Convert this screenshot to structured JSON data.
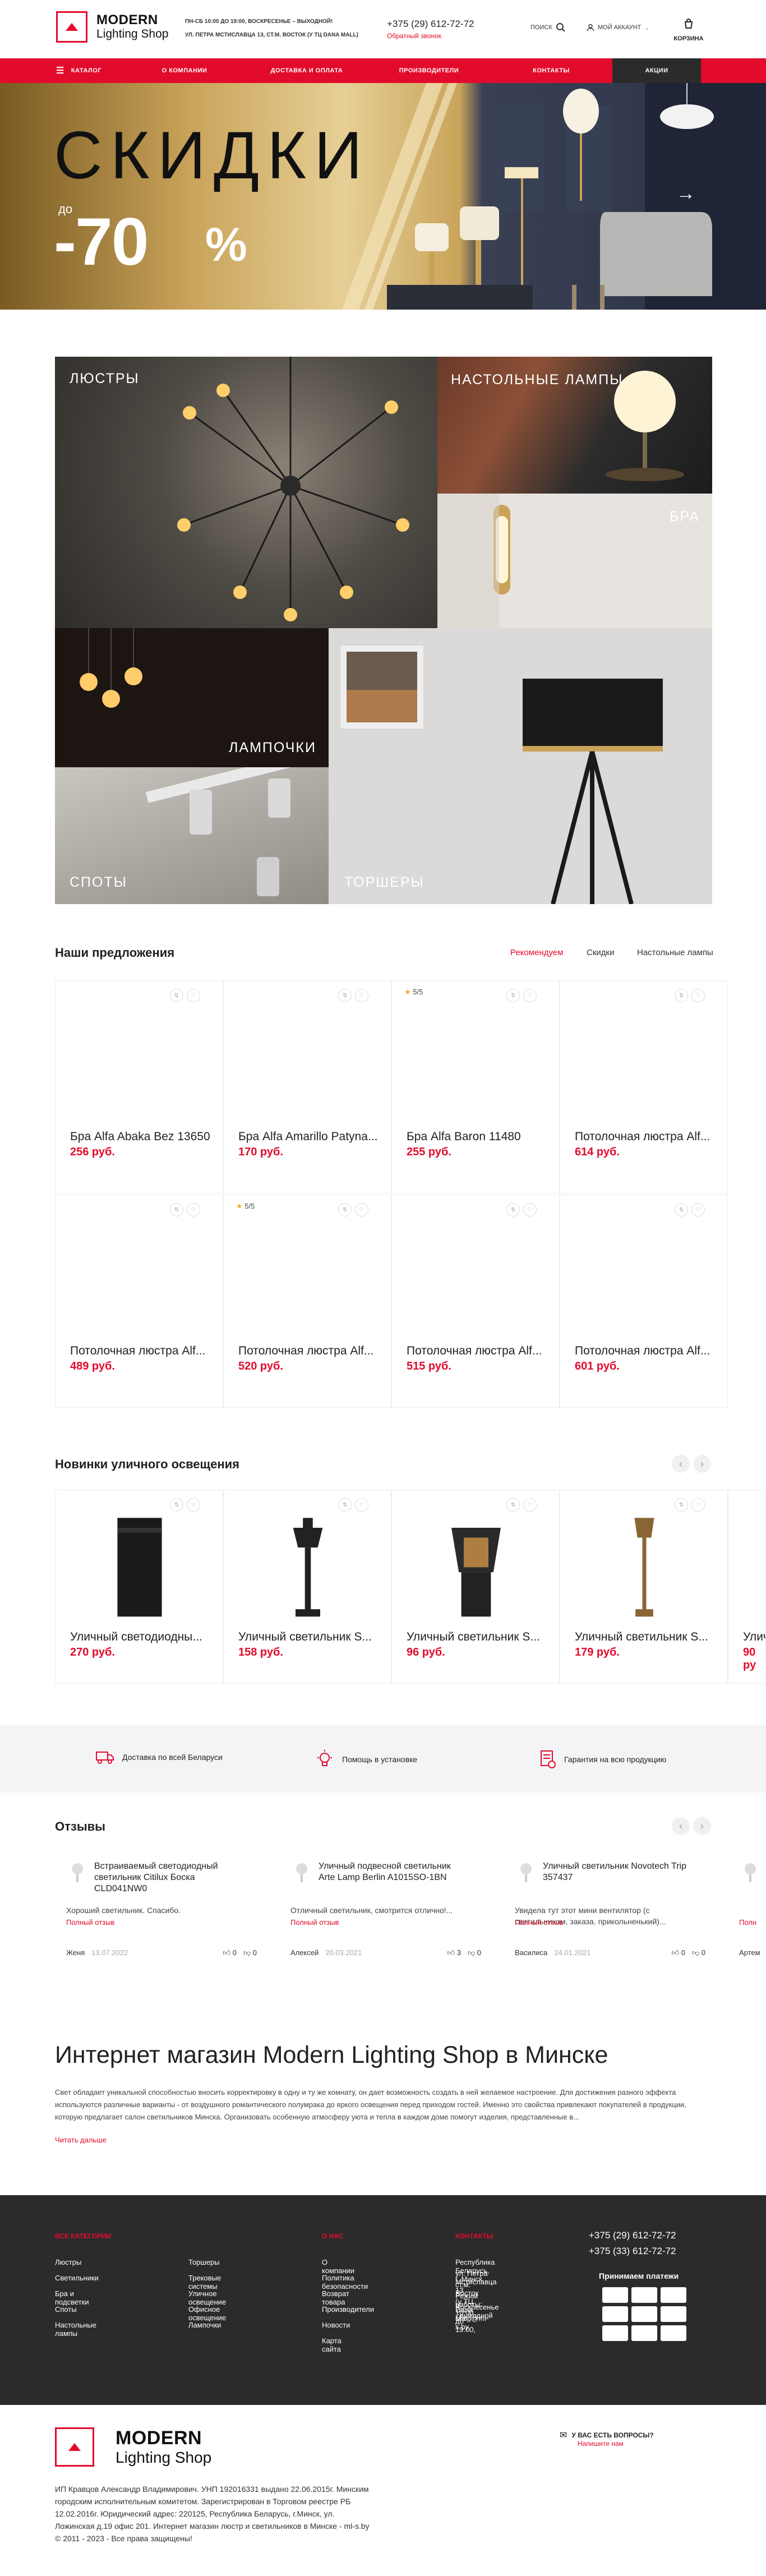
{
  "header": {
    "logo_line1": "MODERN",
    "logo_line2": "Lighting Shop",
    "hours": "ПН-СБ 10:00 ДО 19:00, ВОСКРЕСЕНЬЕ – ВЫХОДНОЙ!",
    "address": "УЛ. ПЕТРА МСТИСЛАВЦА 13, СТ.М. ВОСТОК (У ТЦ DANA MALL)",
    "phone": "+375 (29) 612-72-72",
    "callback": "Обратный звонок",
    "search_label": "ПОИСК",
    "account_label": "МОЙ АККАУНТ",
    "cart_label": "КОРЗИНА"
  },
  "nav": [
    "Каталог",
    "О компании",
    "Доставка и оплата",
    "Производители",
    "Контакты",
    "Акции"
  ],
  "banner": {
    "title": "СКИДКИ",
    "prefix": "до",
    "value": "-70",
    "unit": "%"
  },
  "categories": [
    "Люстры",
    "Настольные лампы",
    "Бра",
    "Лампочки",
    "Споты",
    "Торшеры"
  ],
  "offers": {
    "title": "Наши предложения",
    "tabs": [
      "Рекомендуем",
      "Скидки",
      "Настольные лампы"
    ],
    "products": [
      {
        "name": "Бра Alfa Abaka Bez 13650",
        "price": "256 руб.",
        "rating": ""
      },
      {
        "name": "Бра Alfa Amarillo Patyna...",
        "price": "170 руб.",
        "rating": ""
      },
      {
        "name": "Бра Alfa Baron 11480",
        "price": "255 руб.",
        "rating": "5/5"
      },
      {
        "name": "Потолочная люстра Alf...",
        "price": "614 руб.",
        "rating": ""
      },
      {
        "name": "Потолочная люстра Alf...",
        "price": "489 руб.",
        "rating": ""
      },
      {
        "name": "Потолочная люстра Alf...",
        "price": "520 руб.",
        "rating": "5/5"
      },
      {
        "name": "Потолочная люстра Alf...",
        "price": "515 руб.",
        "rating": ""
      },
      {
        "name": "Потолочная люстра Alf...",
        "price": "601 руб.",
        "rating": ""
      }
    ]
  },
  "street": {
    "title": "Новинки уличного освещения",
    "products": [
      {
        "name": "Уличный светодиодны...",
        "price": "270 руб."
      },
      {
        "name": "Уличный светильник S...",
        "price": "158 руб."
      },
      {
        "name": "Уличный светильник S...",
        "price": "96 руб."
      },
      {
        "name": "Уличный светильник S...",
        "price": "179 руб."
      },
      {
        "name": "Улич",
        "price": "90 ру"
      }
    ]
  },
  "features": [
    "Доставка по всей Беларуси",
    "Помощь в установке",
    "Гарантия на всю продукцию"
  ],
  "reviews": {
    "title": "Отзывы",
    "items": [
      {
        "product": "Встраиваемый светодиодный светильник Citilux Боска CLD041NW0",
        "text": "Хороший светильник. Спасибо.",
        "full": "Полный отзыв",
        "author": "Женя",
        "date": "13.07.2022",
        "likes": "0",
        "dislikes": "0"
      },
      {
        "product": "Уличный подвесной светильник Arte Lamp Berlin A1015SO-1BN",
        "text": "Отличный светильник, смотрится отлично!...",
        "full": "Полный отзыв",
        "author": "Алексей",
        "date": "20.03.2021",
        "likes": "3",
        "dislikes": "0"
      },
      {
        "product": "Уличный светильник Novotech Trip 357437",
        "text": "Увидела тут этот мини вентилятор (с светильником, заказа. прикольненький)...",
        "full": "Полный отзыв",
        "author": "Василиса",
        "date": "24.01.2021",
        "likes": "0",
        "dislikes": "0"
      },
      {
        "product": "",
        "text": "",
        "full": "Полн",
        "author": "Артем",
        "date": "",
        "likes": "",
        "dislikes": ""
      }
    ]
  },
  "seo": {
    "title": "Интернет магазин Modern Lighting Shop в Минске",
    "text": "Свет обладает уникальной способностью вносить корректировку в одну и ту же комнату, он дает возможность создать в ней желаемое настроение. Для достижения разного эффекта используются различные варианты - от воздушного романтического полумрака до яркого освещения перед приходом гостей. Именно это свойства привлекают покупателей в продукции, которую предлагает салон светильников Минска. Организовать особенную атмосферу уюта и тепла в каждом доме помогут изделия, представленные в...",
    "more": "Читать дальше"
  },
  "footer": {
    "col1_title": "Все категории",
    "col1": [
      "Люстры",
      "Светильники",
      "Бра и подсветки",
      "Споты",
      "Настольные лампы"
    ],
    "col2": [
      "Торшеры",
      "Трековые системы",
      "Уличное освещение",
      "Офисное освещение",
      "Лампочки"
    ],
    "col3_title": "О нас",
    "col3": [
      "О компании",
      "Политика безопасности",
      "Возврат товара",
      "Производители",
      "Новости",
      "Карта сайта"
    ],
    "col4_title": "Контакты",
    "contacts": [
      "Республика Беларусь, г. Минск,",
      "ул. Петра Мстиславца 13",
      "ст.м. Восток (у ТЦ Dana Mall)",
      "Режим работы: 10:00 до 19:00,",
      "Воскресенье - выходной",
      "shop@ml-s.by"
    ],
    "phones": [
      "+375 (29) 612-72-72",
      "+375 (33) 612-72-72"
    ],
    "pay_title": "Принимаем платежи"
  },
  "bottom": {
    "logo_line1": "MODERN",
    "logo_line2": "Lighting Shop",
    "question": "У ВАС ЕСТЬ ВОПРОСЫ?",
    "write": "Напишите нам",
    "legal": [
      "ИП Кравцов Александр Владимирович. УНП 192016331 выдано 22.06.2015г. Минским",
      "городским исполнительным комитетом. Зарегистрирован в Торговом реестре РБ",
      "12.02.2016г. Юридический адрес: 220125, Республика Беларусь, г.Минск, ул.",
      "Ложинская д.19 офис 201. Интернет магазин люстр и светильников в Минске - ml-s.by",
      "© 2011 - 2023 - Все права защищены!"
    ]
  },
  "colors": {
    "accent": "#e30b2b",
    "dark": "#2b2b2b"
  }
}
